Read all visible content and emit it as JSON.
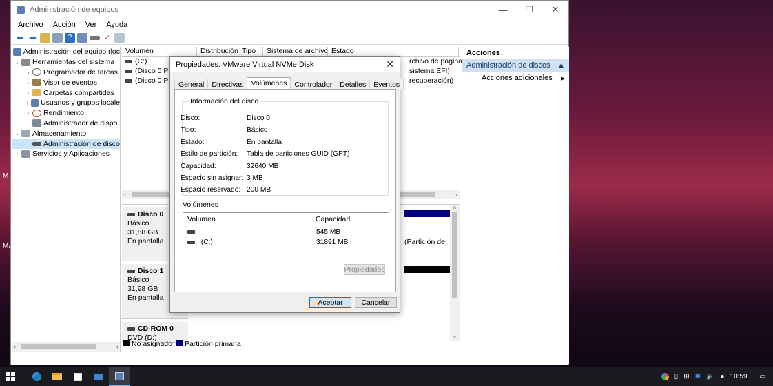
{
  "desktop": {
    "left_text_1": "M",
    "left_text_2": "Ma"
  },
  "window": {
    "title": "Administración de equipos",
    "controls": {
      "minimize": "—",
      "maximize": "☐",
      "close": "✕"
    }
  },
  "menu": [
    "Archivo",
    "Acción",
    "Ver",
    "Ayuda"
  ],
  "tree": {
    "items": [
      {
        "label": "Administración del equipo (loc",
        "icon": "computer-management-icon"
      },
      {
        "label": "Herramientas del sistema",
        "icon": "tools-icon"
      },
      {
        "label": "Programador de tareas",
        "icon": "clock-icon"
      },
      {
        "label": "Visor de eventos",
        "icon": "event-viewer-icon"
      },
      {
        "label": "Carpetas compartidas",
        "icon": "shared-folder-icon"
      },
      {
        "label": "Usuarios y grupos locale",
        "icon": "users-icon"
      },
      {
        "label": "Rendimiento",
        "icon": "performance-icon"
      },
      {
        "label": "Administrador de dispo",
        "icon": "device-manager-icon"
      },
      {
        "label": "Almacenamiento",
        "icon": "storage-icon"
      },
      {
        "label": "Administración de disco",
        "icon": "disk-management-icon"
      },
      {
        "label": "Servicios y Aplicaciones",
        "icon": "services-icon"
      }
    ]
  },
  "volume_list": {
    "headers": [
      "Volumen",
      "Distribución",
      "Tipo",
      "Sistema de archivos",
      "Estado"
    ],
    "rows": [
      {
        "volume": "(C:)",
        "status": "rchivo de paginació"
      },
      {
        "volume": "(Disco 0 Part",
        "status": "sistema EFI)"
      },
      {
        "volume": "(Disco 0 Part",
        "status": "recuperación)"
      }
    ]
  },
  "disks": [
    {
      "name": "Disco 0",
      "type": "Básico",
      "size": "31,88 GB",
      "state": "En pantalla",
      "partition_text": "(Partición de"
    },
    {
      "name": "Disco 1",
      "type": "Básico",
      "size": "31,98 GB",
      "state": "En pantalla"
    },
    {
      "name": "CD-ROM 0",
      "type": "DVD (D:)"
    }
  ],
  "legend": [
    {
      "label": "No asignado",
      "color": "#000000"
    },
    {
      "label": "Partición primaria",
      "color": "#00007f"
    }
  ],
  "actions": {
    "header": "Acciones",
    "section": "Administración de discos",
    "more": "Acciones adicionales"
  },
  "dialog": {
    "title": "Propiedades: VMware Virtual NVMe Disk",
    "tabs": [
      "General",
      "Directivas",
      "Volúmenes",
      "Controlador",
      "Detalles",
      "Eventos"
    ],
    "active_tab": "Volúmenes",
    "group_title": "Información del disco",
    "fields": [
      {
        "label": "Disco:",
        "value": "Disco 0"
      },
      {
        "label": "Tipo:",
        "value": "Básico"
      },
      {
        "label": "Estado:",
        "value": "En pantalla"
      },
      {
        "label": "Estilo de partición:",
        "value": "Tabla de particiones GUID (GPT)"
      },
      {
        "label": "Capacidad:",
        "value": "32640 MB"
      },
      {
        "label": "Espacio sin asignar:",
        "value": "3 MB"
      },
      {
        "label": "Espacio reservado:",
        "value": "200 MB"
      }
    ],
    "volumes_label": "Volúmenes",
    "volumes_table": {
      "headers": [
        "Volumen",
        "Capacidad"
      ],
      "rows": [
        {
          "volume": "",
          "capacity": "545 MB"
        },
        {
          "volume": "(C:)",
          "capacity": "31891 MB"
        }
      ]
    },
    "properties_button": "Propiedades",
    "ok_button": "Aceptar",
    "cancel_button": "Cancelar"
  },
  "taskbar": {
    "clock": "10:59"
  }
}
